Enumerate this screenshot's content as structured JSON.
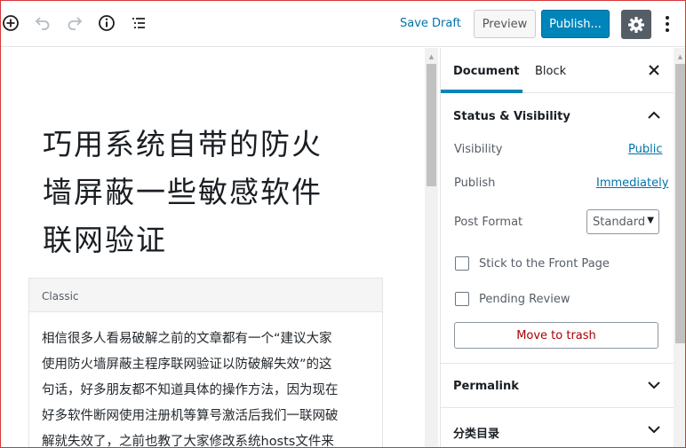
{
  "toolbar": {
    "add_icon": "plus-circle-icon",
    "undo_icon": "undo-icon",
    "redo_icon": "redo-icon",
    "info_icon": "info-icon",
    "outline_icon": "list-icon",
    "save_draft": "Save Draft",
    "preview": "Preview",
    "publish": "Publish...",
    "settings_icon": "gear-icon",
    "more_icon": "more-vertical-icon"
  },
  "editor": {
    "title_lines": [
      "巧用系统自带的防火",
      "墙屏蔽一些敏感软件",
      "联网验证"
    ],
    "classic_label": "Classic",
    "body_lines": [
      "相信很多人看易破解之前的文章都有一个“建议大家",
      "使用防火墙屏蔽主程序联网验证以防破解失效”的这",
      "句话，好多朋友都不知道具体的操作方法，因为现在",
      "好多软件断网使用注册机等算号激活后我们一联网破",
      "解就失效了，之前也教了大家修改系统hosts文件来"
    ]
  },
  "sidebar": {
    "tabs": [
      "Document",
      "Block"
    ],
    "close_icon": "close-icon",
    "status_visibility": {
      "title": "Status & Visibility",
      "visibility_label": "Visibility",
      "visibility_value": "Public",
      "publish_label": "Publish",
      "publish_value": "Immediately",
      "post_format_label": "Post Format",
      "post_format_value": "Standard",
      "stick_label": "Stick to the Front Page",
      "pending_label": "Pending Review",
      "trash_label": "Move to trash"
    },
    "permalink_title": "Permalink",
    "categories_title": "分类目录"
  },
  "colors": {
    "accent": "#0085ba",
    "link": "#0073aa",
    "danger": "#a00000",
    "gear_bg": "#555d66"
  }
}
